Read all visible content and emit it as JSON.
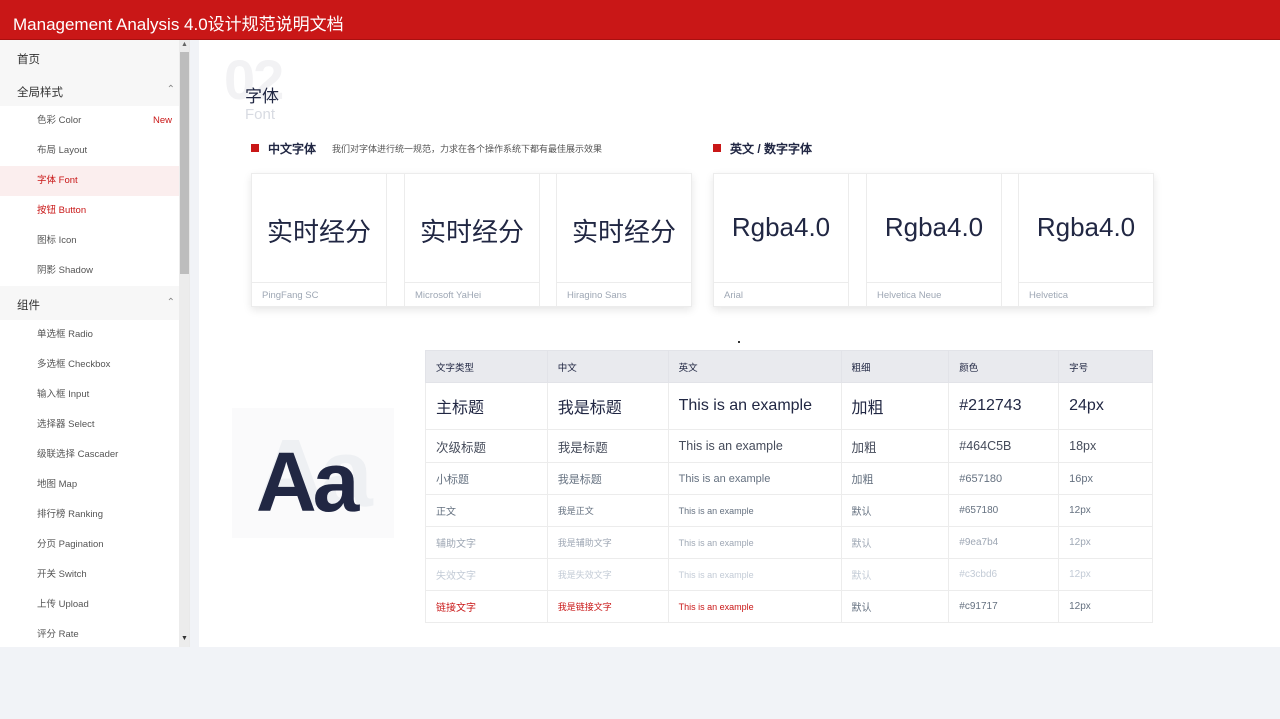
{
  "app": {
    "title": "Management Analysis 4.0设计规范说明文档"
  },
  "sidebar": {
    "home": "首页",
    "global_group": "全局样式",
    "global_items": [
      {
        "label": "色彩 Color",
        "badge": "New"
      },
      {
        "label": "布局 Layout"
      },
      {
        "label": "字体 Font"
      },
      {
        "label": "按钮 Button"
      },
      {
        "label": "图标 Icon"
      },
      {
        "label": "阴影 Shadow"
      }
    ],
    "components_group": "组件",
    "component_items": [
      "单选框 Radio",
      "多选框 Checkbox",
      "输入框 Input",
      "选择器 Select",
      "级联选择 Cascader",
      "地图  Map",
      "排行榜  Ranking",
      "分页 Pagination",
      "开关 Switch",
      "上传 Upload",
      "评分 Rate"
    ]
  },
  "section": {
    "number": "02",
    "title": "字体",
    "subtitle": "Font"
  },
  "chinese_fonts": {
    "label": "中文字体",
    "description": "我们对字体进行统一规范，力求在各个操作系统下都有最佳展示效果",
    "sample": "实时经分",
    "fonts": [
      "PingFang SC",
      "Microsoft YaHei",
      "Hiragino Sans"
    ]
  },
  "english_fonts": {
    "label": "英文 / 数字字体",
    "sample": "Rgba4.0",
    "fonts": [
      "Arial",
      "Helvetica Neue",
      "Helvetica"
    ]
  },
  "decor": {
    "letters": "Aa"
  },
  "table": {
    "headers": [
      "文字类型",
      "中文",
      "英文",
      "粗细",
      "颜色",
      "字号"
    ],
    "rows": [
      [
        "主标题",
        "我是标题",
        "This is an example",
        "加粗",
        "#212743",
        "24px"
      ],
      [
        "次级标题",
        "我是标题",
        "This is an example",
        "加粗",
        "#464C5B",
        "18px"
      ],
      [
        "小标题",
        "我是标题",
        "This is an example",
        "加粗",
        "#657180",
        "16px"
      ],
      [
        "正文",
        "我是正文",
        "This is an example",
        "默认",
        "#657180",
        "12px"
      ],
      [
        "辅助文字",
        "我是辅助文字",
        "This is an example",
        "默认",
        "#9ea7b4",
        "12px"
      ],
      [
        "失效文字",
        "我是失效文字",
        "This is an example",
        "默认",
        "#c3cbd6",
        "12px"
      ],
      [
        "链接文字",
        "我是链接文字",
        "This is an example",
        "默认",
        "#c91717",
        "12px"
      ]
    ]
  },
  "colors": {
    "brand": "#c91717",
    "title": "#212743",
    "subtitle": "#464C5B",
    "body": "#657180",
    "aux": "#9ea7b4",
    "disabled": "#c3cbd6"
  }
}
